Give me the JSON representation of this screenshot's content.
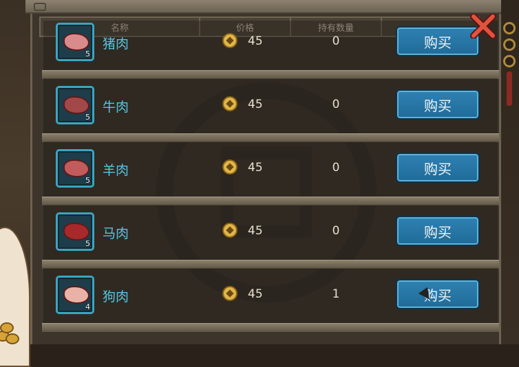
{
  "header": {
    "col_name": "名称",
    "col_price": "价格",
    "col_owned": "持有数量"
  },
  "buy_label": "购买",
  "items": [
    {
      "name": "猪肉",
      "price": "45",
      "owned": "0",
      "stack": "5",
      "icon": "pork-icon",
      "color": "#d98a8a"
    },
    {
      "name": "牛肉",
      "price": "45",
      "owned": "0",
      "stack": "5",
      "icon": "beef-icon",
      "color": "#a34848"
    },
    {
      "name": "羊肉",
      "price": "45",
      "owned": "0",
      "stack": "5",
      "icon": "mutton-icon",
      "color": "#c25b5b"
    },
    {
      "name": "马肉",
      "price": "45",
      "owned": "0",
      "stack": "5",
      "icon": "horse-meat-icon",
      "color": "#a8292b"
    },
    {
      "name": "狗肉",
      "price": "45",
      "owned": "1",
      "stack": "4",
      "icon": "dog-meat-icon",
      "color": "#e8b3a6"
    }
  ]
}
